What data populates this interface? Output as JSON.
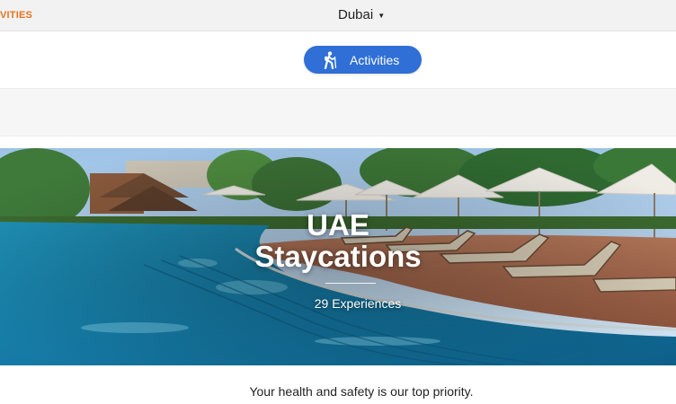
{
  "topbar": {
    "brand_fragment": "VITIES",
    "city": "Dubai",
    "caret_icon": "caret-down-icon"
  },
  "category_pill": {
    "label": "Activities",
    "icon": "hiker-icon",
    "color": "#2f6fd6"
  },
  "hero": {
    "title_line1": "UAE",
    "title_line2": "Staycations",
    "experience_count": "29 Experiences"
  },
  "footer_note": "Your health and safety is our top priority.",
  "colors": {
    "brand_orange": "#e8711c",
    "pill_blue": "#2f6fd6"
  }
}
